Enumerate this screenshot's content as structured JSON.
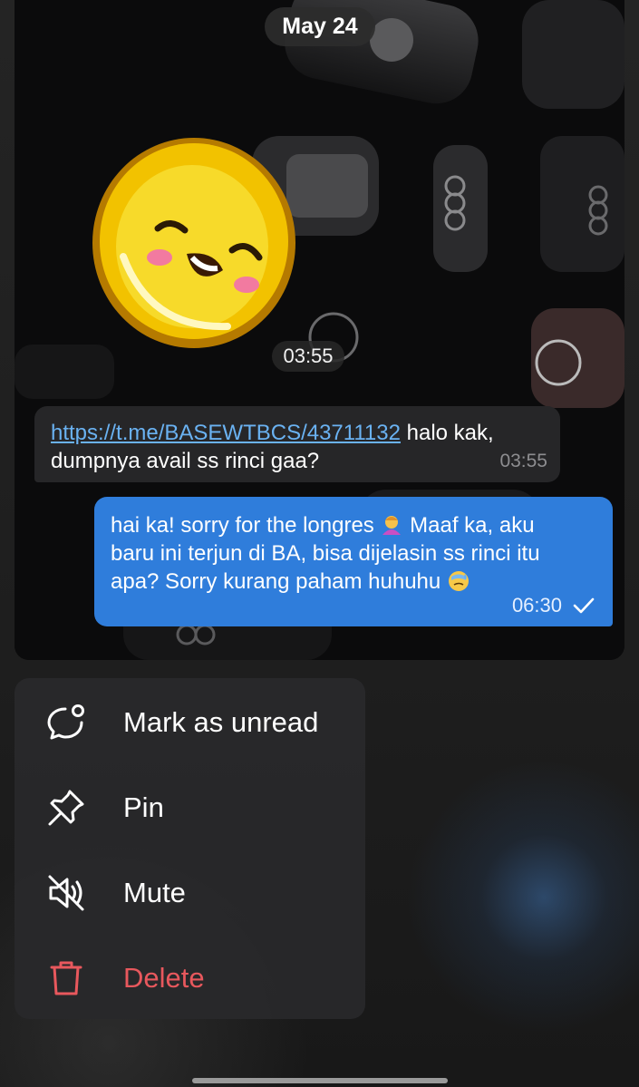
{
  "chat": {
    "date_label": "May 24",
    "sticker": {
      "name": "smiling-coin-sticker",
      "time": "03:55"
    },
    "incoming_message": {
      "link": "https://t.me/BASEWTBCS/43711132",
      "text_line1": " halo kak,",
      "text_line2": "dumpnya avail ss rinci gaa?",
      "time": "03:55"
    },
    "outgoing_message": {
      "line1_a": "hai ka! sorry for the longres ",
      "line1_emoji": "person-bowing-emoji",
      "line1_b": " Maaf ka, aku",
      "line2": "baru ini terjun di BA, bisa dijelasin ss rinci itu",
      "line3": "apa? Sorry kurang paham huhuhu ",
      "line3_emoji": "sweat-smile-emoji",
      "time": "06:30",
      "status_icon": "single-check-icon"
    }
  },
  "context_menu": {
    "items": [
      {
        "label": "Mark as unread",
        "icon": "chat-bubble-dot-icon"
      },
      {
        "label": "Pin",
        "icon": "pin-icon"
      },
      {
        "label": "Mute",
        "icon": "speaker-muted-icon"
      },
      {
        "label": "Delete",
        "icon": "trash-icon"
      }
    ]
  },
  "colors": {
    "outgoing_bubble": "#2f7ddb",
    "incoming_bubble": "#262628",
    "link": "#6ab2f2",
    "delete": "#e8585d",
    "menu_background": "#28282a"
  }
}
